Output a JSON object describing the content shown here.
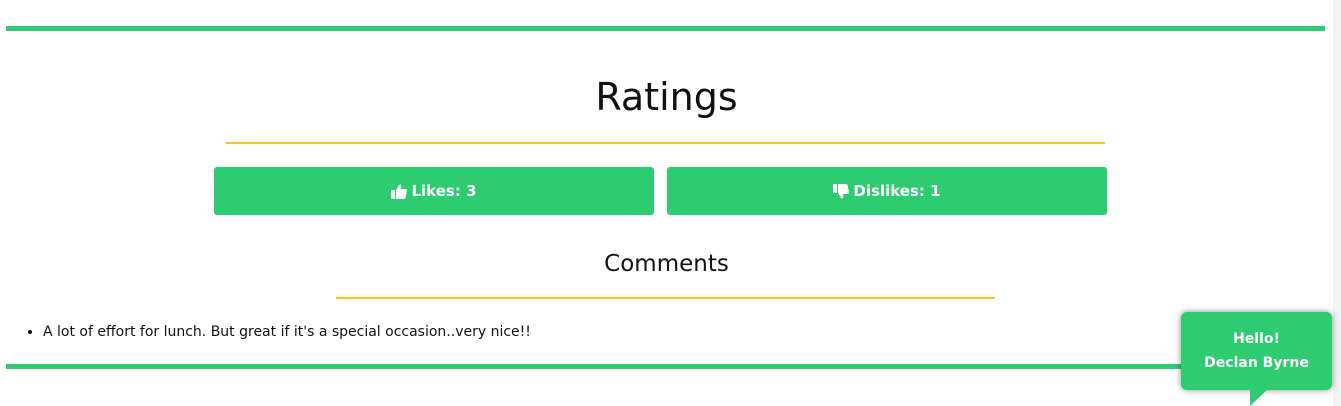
{
  "ratings": {
    "title": "Ratings",
    "likes_label": "Likes: 3",
    "dislikes_label": "Dislikes: 1"
  },
  "comments": {
    "title": "Comments",
    "items": [
      "A lot of effort for lunch. But great if it's a special occasion..very nice!!"
    ]
  },
  "greeting": {
    "line1": "Hello!",
    "line2": "Declan Byrne"
  },
  "icons": {
    "likes": "thumbs-up-icon",
    "dislikes": "thumbs-down-icon"
  },
  "colors": {
    "primary": "#2ecc71",
    "accent": "#f5c518",
    "text": "#111111"
  }
}
